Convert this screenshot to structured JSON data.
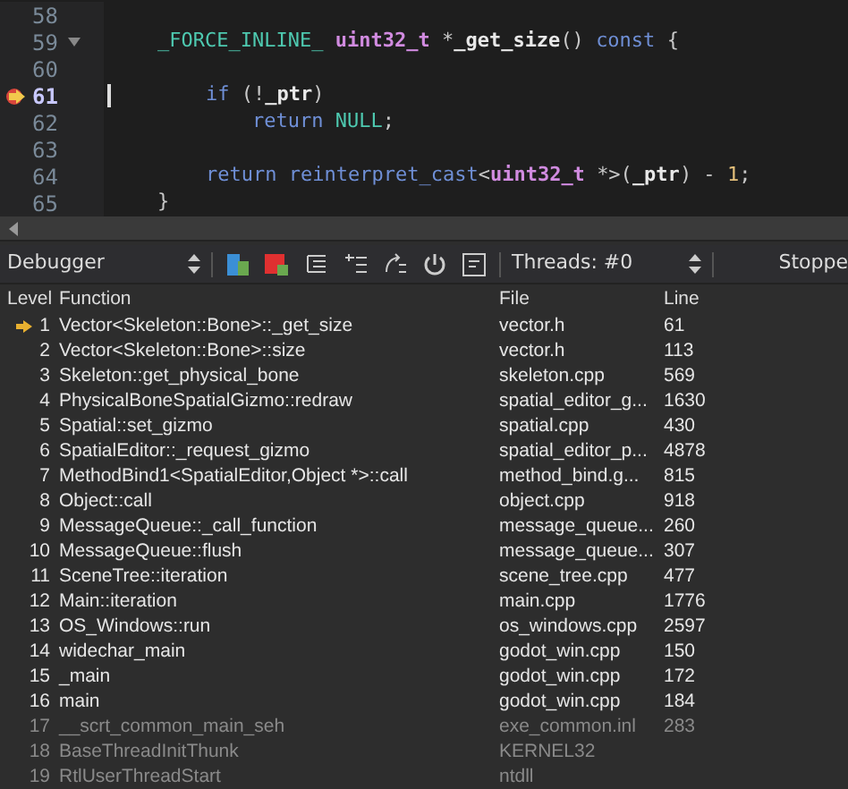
{
  "editor": {
    "lines": [
      {
        "number": "58",
        "current": false,
        "foldable": false
      },
      {
        "number": "59",
        "current": false,
        "foldable": true,
        "tokens": [
          {
            "kind": "indent1"
          },
          {
            "kind": "macro",
            "text": "_FORCE_INLINE_ "
          },
          {
            "kind": "type",
            "text": "uint32_t "
          },
          {
            "kind": "punct",
            "text": "*"
          },
          {
            "kind": "ident",
            "text": "_get_size"
          },
          {
            "kind": "punct",
            "text": "() "
          },
          {
            "kind": "keyword",
            "text": "const "
          },
          {
            "kind": "punct",
            "text": "{"
          }
        ]
      },
      {
        "number": "60",
        "current": false,
        "foldable": false
      },
      {
        "number": "61",
        "current": true,
        "foldable": false,
        "tokens": [
          {
            "kind": "indent2"
          },
          {
            "kind": "keyword",
            "text": "if "
          },
          {
            "kind": "punct",
            "text": "(!"
          },
          {
            "kind": "ident",
            "text": "_ptr"
          },
          {
            "kind": "punct",
            "text": ")"
          }
        ]
      },
      {
        "number": "62",
        "current": false,
        "foldable": false,
        "tokens": [
          {
            "kind": "indent3"
          },
          {
            "kind": "keyword",
            "text": "return "
          },
          {
            "kind": "macro",
            "text": "NULL"
          },
          {
            "kind": "punct",
            "text": ";"
          }
        ]
      },
      {
        "number": "63",
        "current": false,
        "foldable": false
      },
      {
        "number": "64",
        "current": false,
        "foldable": false,
        "tokens": [
          {
            "kind": "indent2"
          },
          {
            "kind": "keyword",
            "text": "return reinterpret_cast"
          },
          {
            "kind": "punct",
            "text": "<"
          },
          {
            "kind": "type",
            "text": "uint32_t "
          },
          {
            "kind": "punct",
            "text": "*>("
          },
          {
            "kind": "ident",
            "text": "_ptr"
          },
          {
            "kind": "punct",
            "text": ") - "
          },
          {
            "kind": "number",
            "text": "1"
          },
          {
            "kind": "punct",
            "text": ";"
          }
        ]
      },
      {
        "number": "65",
        "current": false,
        "foldable": false,
        "tokens": [
          {
            "kind": "indent1"
          },
          {
            "kind": "punct",
            "text": "}"
          }
        ]
      }
    ]
  },
  "toolbar": {
    "mode": "Debugger",
    "threads": "Threads: #0",
    "status": "Stoppe"
  },
  "table": {
    "columns": [
      "Level",
      "Function",
      "File",
      "Line"
    ],
    "rows": [
      {
        "level": "1",
        "function": "Vector<Skeleton::Bone>::_get_size",
        "file": "vector.h",
        "line": "61",
        "current": true,
        "dimmed": false
      },
      {
        "level": "2",
        "function": "Vector<Skeleton::Bone>::size",
        "file": "vector.h",
        "line": "113",
        "current": false,
        "dimmed": false
      },
      {
        "level": "3",
        "function": "Skeleton::get_physical_bone",
        "file": "skeleton.cpp",
        "line": "569",
        "current": false,
        "dimmed": false
      },
      {
        "level": "4",
        "function": "PhysicalBoneSpatialGizmo::redraw",
        "file": "spatial_editor_g...",
        "line": "1630",
        "current": false,
        "dimmed": false
      },
      {
        "level": "5",
        "function": "Spatial::set_gizmo",
        "file": "spatial.cpp",
        "line": "430",
        "current": false,
        "dimmed": false
      },
      {
        "level": "6",
        "function": "SpatialEditor::_request_gizmo",
        "file": "spatial_editor_p...",
        "line": "4878",
        "current": false,
        "dimmed": false
      },
      {
        "level": "7",
        "function": "MethodBind1<SpatialEditor,Object *>::call",
        "file": "method_bind.g...",
        "line": "815",
        "current": false,
        "dimmed": false
      },
      {
        "level": "8",
        "function": "Object::call",
        "file": "object.cpp",
        "line": "918",
        "current": false,
        "dimmed": false
      },
      {
        "level": "9",
        "function": "MessageQueue::_call_function",
        "file": "message_queue...",
        "line": "260",
        "current": false,
        "dimmed": false
      },
      {
        "level": "10",
        "function": "MessageQueue::flush",
        "file": "message_queue...",
        "line": "307",
        "current": false,
        "dimmed": false
      },
      {
        "level": "11",
        "function": "SceneTree::iteration",
        "file": "scene_tree.cpp",
        "line": "477",
        "current": false,
        "dimmed": false
      },
      {
        "level": "12",
        "function": "Main::iteration",
        "file": "main.cpp",
        "line": "1776",
        "current": false,
        "dimmed": false
      },
      {
        "level": "13",
        "function": "OS_Windows::run",
        "file": "os_windows.cpp",
        "line": "2597",
        "current": false,
        "dimmed": false
      },
      {
        "level": "14",
        "function": "widechar_main",
        "file": "godot_win.cpp",
        "line": "150",
        "current": false,
        "dimmed": false
      },
      {
        "level": "15",
        "function": "_main",
        "file": "godot_win.cpp",
        "line": "172",
        "current": false,
        "dimmed": false
      },
      {
        "level": "16",
        "function": "main",
        "file": "godot_win.cpp",
        "line": "184",
        "current": false,
        "dimmed": false
      },
      {
        "level": "17",
        "function": "__scrt_common_main_seh",
        "file": "exe_common.inl",
        "line": "283",
        "current": false,
        "dimmed": true
      },
      {
        "level": "18",
        "function": "BaseThreadInitThunk",
        "file": "KERNEL32",
        "current": false,
        "dimmed": true
      },
      {
        "level": "19",
        "function": "RtlUserThreadStart",
        "file": "ntdll",
        "current": false,
        "dimmed": true
      }
    ]
  }
}
